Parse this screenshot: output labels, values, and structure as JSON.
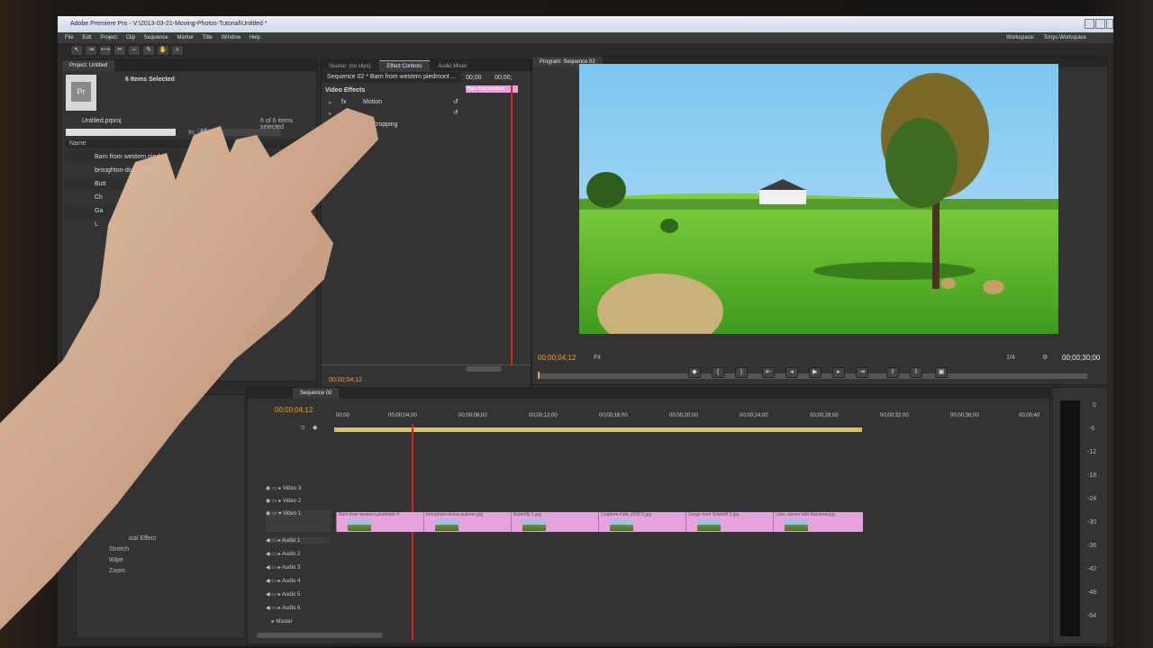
{
  "window": {
    "title": "Adobe Premiere Pro - V:\\2013-03-21-Moving-Photos-Tutorial\\Untitled *",
    "workspace_label": "Workspace:",
    "workspace_value": "Tonys-Workspace"
  },
  "menu": [
    "File",
    "Edit",
    "Project",
    "Clip",
    "Sequence",
    "Marker",
    "Title",
    "Window",
    "Help"
  ],
  "project": {
    "tab": "Project: Untitled",
    "selected": "6 Items Selected",
    "file": "Untitled.prproj",
    "count": "6 of 6 items selected",
    "in_label": "In:",
    "in_value": "All",
    "col_name": "Name",
    "col_frame": "Fram",
    "items": [
      "Barn from western pied",
      "broughton-dome-autu",
      "Butt",
      "Ch",
      "Ga",
      "L"
    ]
  },
  "effects": {
    "items": [
      "ical Effect",
      "Stretch",
      "Wipe",
      "Zoom"
    ]
  },
  "source_tabs": [
    "Source: (no clips)",
    "Effect Controls",
    "Audio Mixer:"
  ],
  "effect_controls": {
    "sequence": "Sequence 02 * Barn from western piedmont ...",
    "time_a": "00;00",
    "time_b": "00;00;",
    "section": "Video Effects",
    "motion": "Motion",
    "row2": "Cropping",
    "clip_tag": "Barn from western",
    "timecode": "00;00;04;12"
  },
  "program": {
    "tab": "Program: Sequence 02",
    "timecode": "00;00;04;12",
    "fit": "Fit",
    "zoom": "1/4",
    "duration": "00;00;30;00"
  },
  "timeline": {
    "tab": "Sequence 02",
    "timecode": "00;00;04;12",
    "ruler": [
      "00;00",
      "00;00;04;00",
      "00;00;08;00",
      "00;00;12;00",
      "00;00;16;00",
      "00;00;20;00",
      "00;00;24;00",
      "00;00;28;00",
      "00;00;32;00",
      "00;00;36;00",
      "00;00;40"
    ],
    "video_tracks": [
      "Video 3",
      "Video 2",
      "Video 1"
    ],
    "audio_tracks": [
      "Audio 1",
      "Audio 2",
      "Audio 3",
      "Audio 4",
      "Audio 5",
      "Audio 6",
      "Master"
    ],
    "clips": [
      "Barn from western piedmont 4",
      "broughton-dome-autumn.jpg",
      "Butterfly-1.jpg",
      "Crabtree Falls 2009 2.jpg",
      "Gorge from Shortoff 2.jpg",
      "Lake James with Rainbow.jpg"
    ]
  },
  "meter": [
    "0",
    "-6",
    "-12",
    "-18",
    "-24",
    "-30",
    "-36",
    "-42",
    "-48",
    "-54"
  ],
  "colors": {
    "accent": "#f0a020",
    "clip": "#e6a2df",
    "playhead": "#e02020"
  }
}
